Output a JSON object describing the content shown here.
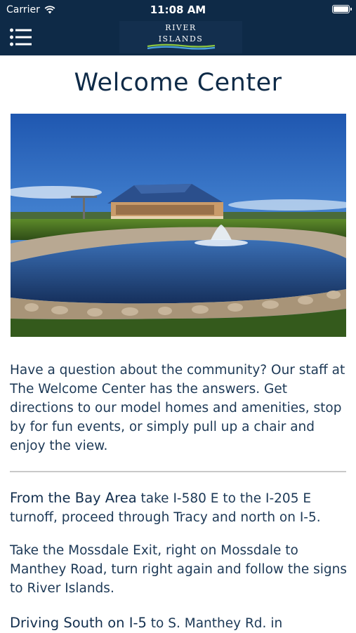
{
  "status": {
    "carrier": "Carrier",
    "time": "11:08 AM"
  },
  "header": {
    "logo_line1": "RIVER",
    "logo_line2": "ISLANDS"
  },
  "page": {
    "title": "Welcome Center",
    "intro": "Have a question about the community? Our staff at The Welcome Center has the answers. Get directions to our model homes and amenities, stop by for fun events, or simply pull up a chair and enjoy the view.",
    "dir1_lead": "From the Bay Area",
    "dir1_text": " take I-580 E to the I-205 E turnoff, proceed through Tracy and north on I-5.",
    "dir2_text": "Take the Mossdale Exit, right on Mossdale to Manthey Road, turn right again and follow the signs to River Islands.",
    "dir3_lead": "Driving South on I-5",
    "dir3_text": " to S. Manthey Rd. in"
  },
  "icons": {
    "menu": "hamburger-menu-icon",
    "wifi": "wifi-icon",
    "battery": "battery-icon"
  },
  "colors": {
    "header": "#0e2a47",
    "text": "#1d3956"
  }
}
